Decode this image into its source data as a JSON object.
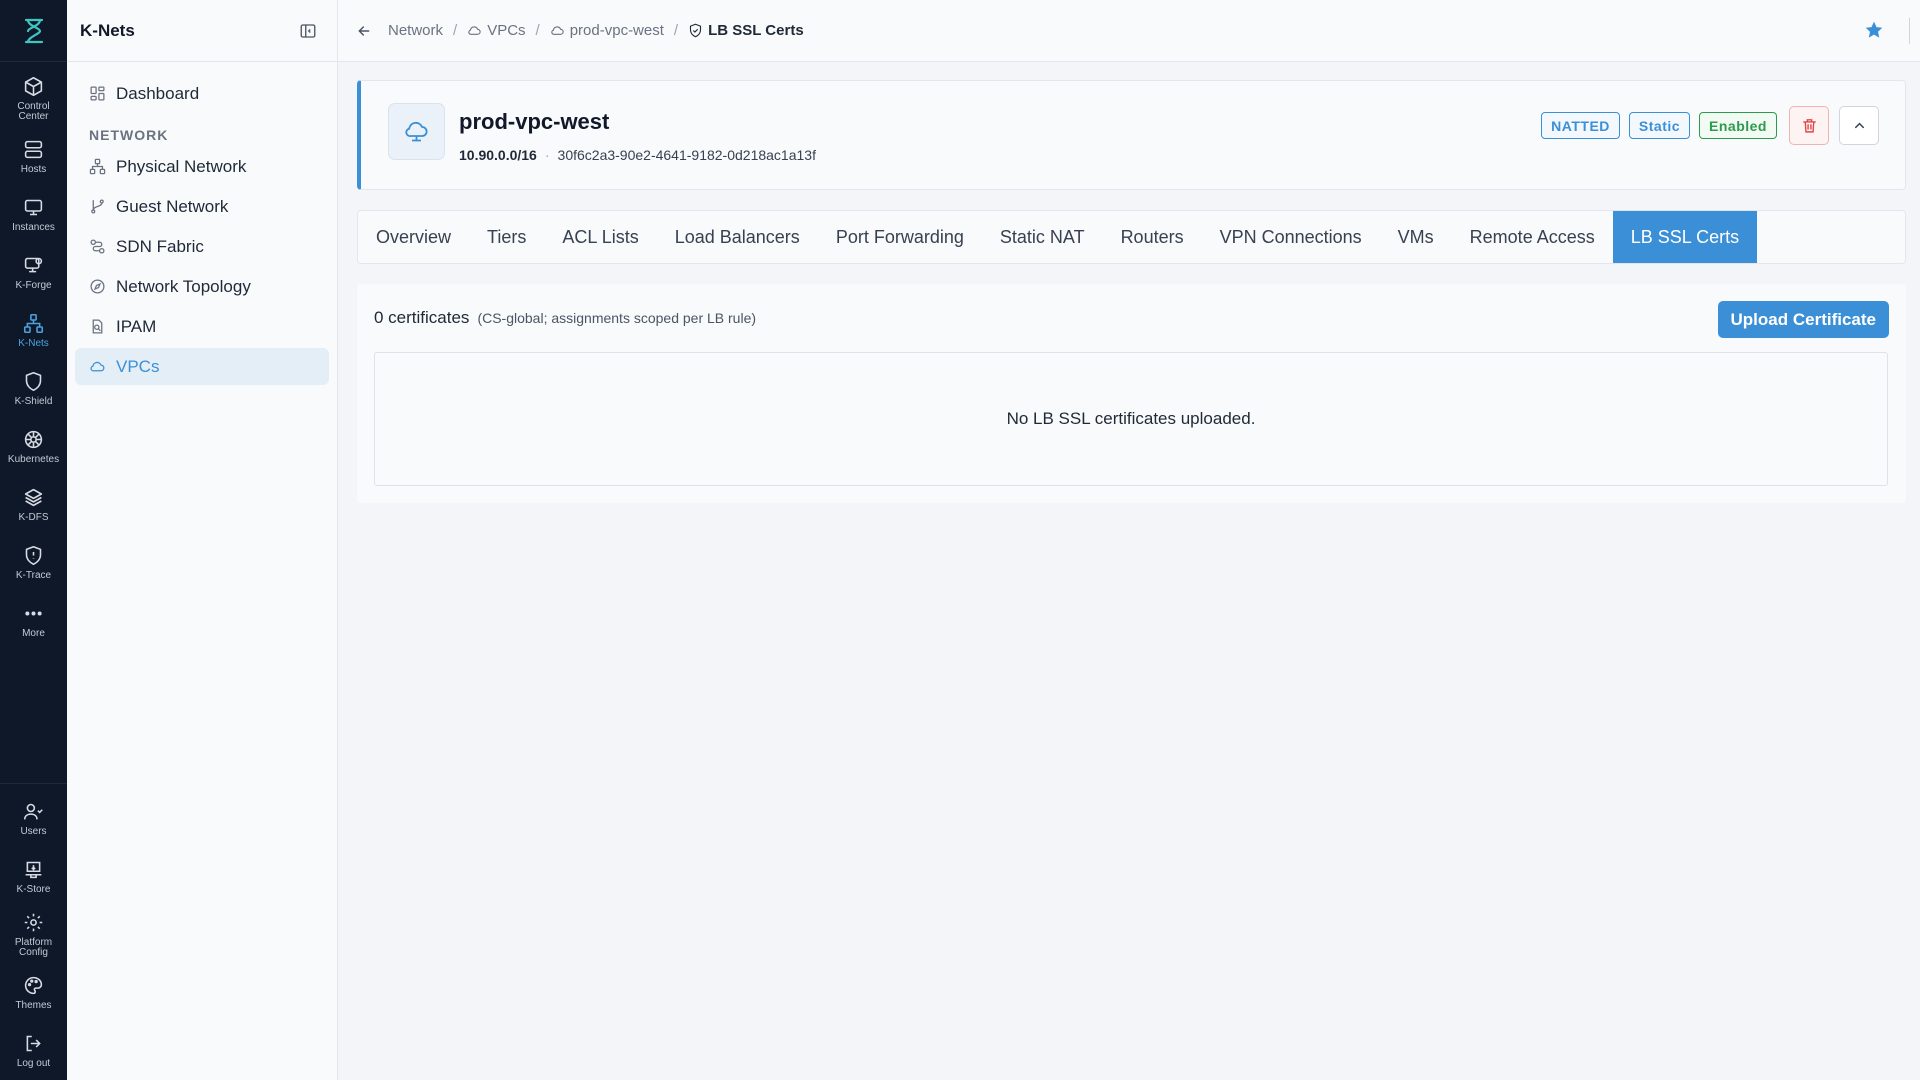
{
  "rail": {
    "items": [
      {
        "label": "Control\nCenter",
        "icon": "cube-icon"
      },
      {
        "label": "Hosts",
        "icon": "server-icon"
      },
      {
        "label": "Instances",
        "icon": "monitor-icon"
      },
      {
        "label": "K-Forge",
        "icon": "forge-icon"
      },
      {
        "label": "K-Nets",
        "icon": "network-icon"
      },
      {
        "label": "K-Shield",
        "icon": "shield-icon"
      },
      {
        "label": "Kubernetes",
        "icon": "helm-icon"
      },
      {
        "label": "K-DFS",
        "icon": "layers-icon"
      },
      {
        "label": "K-Trace",
        "icon": "shield-alert-icon"
      },
      {
        "label": "More",
        "icon": "more-icon"
      }
    ],
    "bottom": [
      {
        "label": "Users",
        "icon": "users-icon"
      },
      {
        "label": "K-Store",
        "icon": "store-icon"
      },
      {
        "label": "Platform\nConfig",
        "icon": "gear-icon"
      },
      {
        "label": "Themes",
        "icon": "palette-icon"
      },
      {
        "label": "Log out",
        "icon": "logout-icon"
      }
    ]
  },
  "sidebar": {
    "title": "K-Nets",
    "dashboard": "Dashboard",
    "section": "NETWORK",
    "items": [
      {
        "label": "Physical Network"
      },
      {
        "label": "Guest Network"
      },
      {
        "label": "SDN Fabric"
      },
      {
        "label": "Network Topology"
      },
      {
        "label": "IPAM"
      },
      {
        "label": "VPCs"
      }
    ]
  },
  "breadcrumb": {
    "network": "Network",
    "vpcs": "VPCs",
    "vpc": "prod-vpc-west",
    "current": "LB SSL Certs"
  },
  "vpc": {
    "name": "prod-vpc-west",
    "cidr": "10.90.0.0/16",
    "id": "30f6c2a3-90e2-4641-9182-0d218ac1a13f",
    "badges": [
      "NATTED",
      "Static",
      "Enabled"
    ]
  },
  "tabs": [
    "Overview",
    "Tiers",
    "ACL Lists",
    "Load Balancers",
    "Port Forwarding",
    "Static NAT",
    "Routers",
    "VPN Connections",
    "VMs",
    "Remote Access",
    "LB SSL Certs"
  ],
  "active_tab": "LB SSL Certs",
  "certs": {
    "count_label": "0 certificates",
    "scope_note": "(CS-global; assignments scoped per LB rule)",
    "upload_label": "Upload Certificate",
    "empty_message": "No LB SSL certificates uploaded."
  },
  "colors": {
    "accent": "#3b8fd6",
    "rail_bg": "#0f1828",
    "success": "#2e9a4e",
    "danger": "#e04848"
  }
}
